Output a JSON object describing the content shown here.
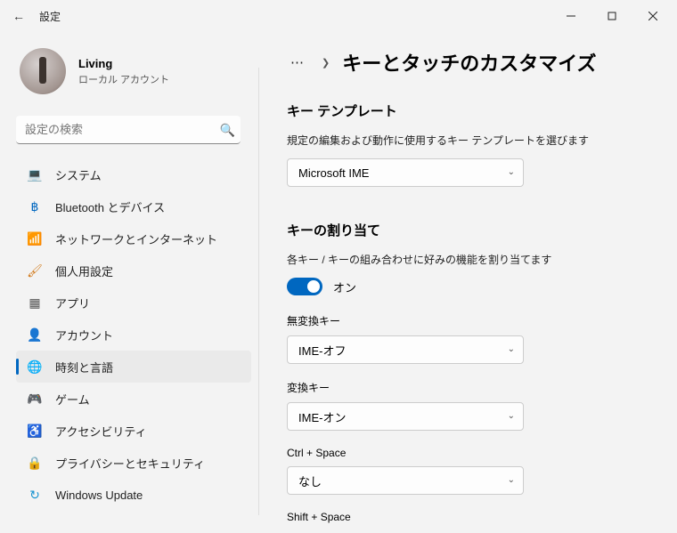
{
  "window": {
    "title": "設定"
  },
  "user": {
    "name": "Living",
    "subtitle": "ローカル アカウント"
  },
  "search": {
    "placeholder": "設定の検索"
  },
  "nav": [
    {
      "label": "システム"
    },
    {
      "label": "Bluetooth とデバイス"
    },
    {
      "label": "ネットワークとインターネット"
    },
    {
      "label": "個人用設定"
    },
    {
      "label": "アプリ"
    },
    {
      "label": "アカウント"
    },
    {
      "label": "時刻と言語"
    },
    {
      "label": "ゲーム"
    },
    {
      "label": "アクセシビリティ"
    },
    {
      "label": "プライバシーとセキュリティ"
    },
    {
      "label": "Windows Update"
    }
  ],
  "page": {
    "title": "キーとタッチのカスタマイズ",
    "template_section": {
      "heading": "キー テンプレート",
      "desc": "規定の編集および動作に使用するキー テンプレートを選びます",
      "value": "Microsoft IME"
    },
    "assign_section": {
      "heading": "キーの割り当て",
      "desc": "各キー / キーの組み合わせに好みの機能を割り当てます",
      "toggle_label": "オン",
      "fields": [
        {
          "label": "無変換キー",
          "value": "IME-オフ"
        },
        {
          "label": "変換キー",
          "value": "IME-オン"
        },
        {
          "label": "Ctrl + Space",
          "value": "なし"
        },
        {
          "label": "Shift + Space"
        }
      ]
    }
  }
}
